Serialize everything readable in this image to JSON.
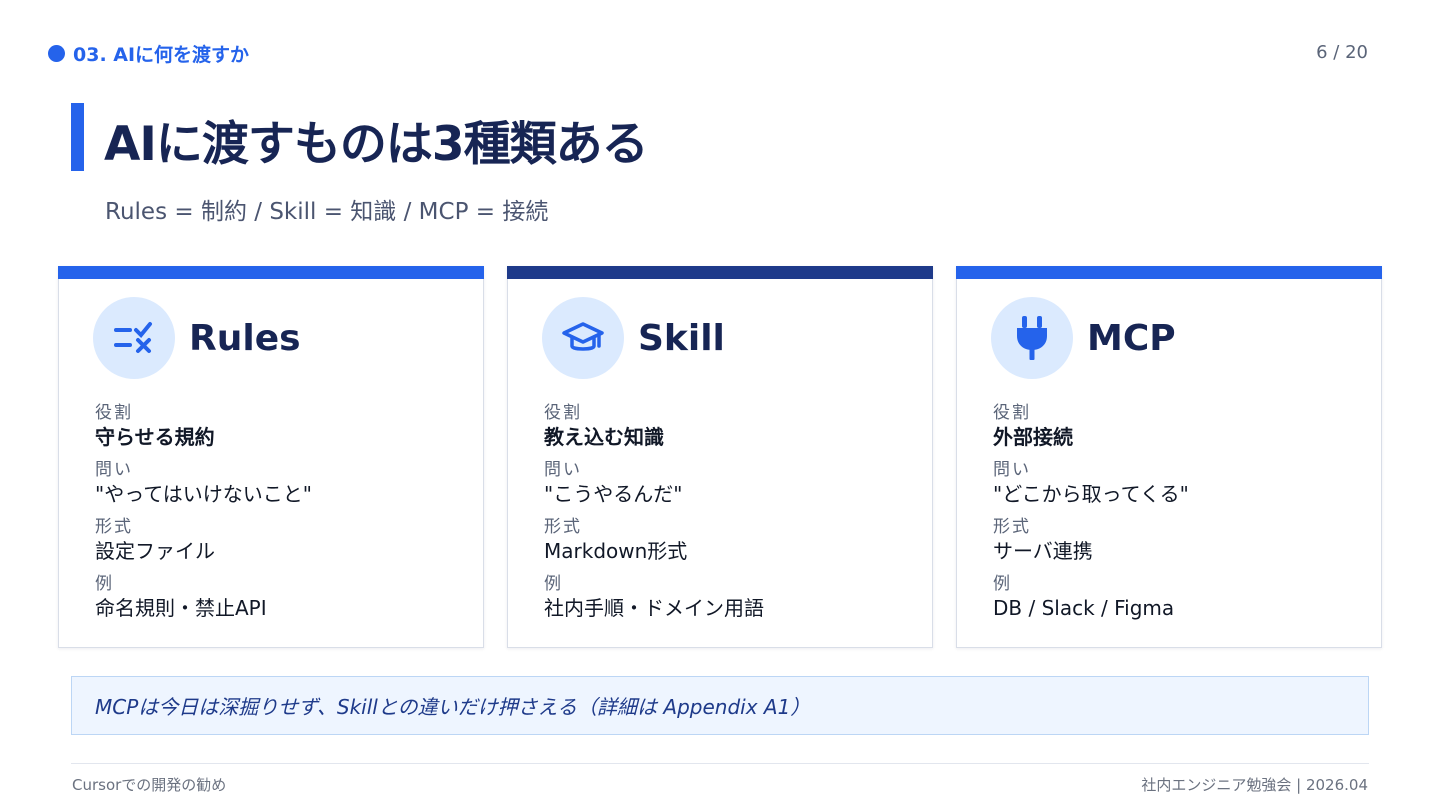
{
  "header": {
    "section": "03. AIに何を渡すか",
    "page": "6 / 20"
  },
  "title": "AIに渡すものは3種類ある",
  "subtitle": "Rules = 制約 / Skill = 知識 / MCP = 接続",
  "colors": {
    "accent": "#2563eb",
    "navy": "#1e3a8a",
    "icon_bg": "#dbeafe",
    "title": "#172554"
  },
  "cards": [
    {
      "name": "Rules",
      "icon": "checklist-icon",
      "role_label": "役割",
      "role": "守らせる規約",
      "question_label": "問い",
      "question": "\"やってはいけないこと\"",
      "format_label": "形式",
      "format": "設定ファイル",
      "example_label": "例",
      "example": "命名規則・禁止API"
    },
    {
      "name": "Skill",
      "icon": "graduation-cap-icon",
      "role_label": "役割",
      "role": "教え込む知識",
      "question_label": "問い",
      "question": "\"こうやるんだ\"",
      "format_label": "形式",
      "format": "Markdown形式",
      "example_label": "例",
      "example": "社内手順・ドメイン用語"
    },
    {
      "name": "MCP",
      "icon": "plug-icon",
      "role_label": "役割",
      "role": "外部接続",
      "question_label": "問い",
      "question": "\"どこから取ってくる\"",
      "format_label": "形式",
      "format": "サーバ連携",
      "example_label": "例",
      "example": "DB / Slack / Figma"
    }
  ],
  "note": "MCPは今日は深掘りせず、Skillとの違いだけ押さえる（詳細は Appendix A1）",
  "footer": {
    "left": "Cursorでの開発の勧め",
    "right": "社内エンジニア勉強会 | 2026.04"
  }
}
